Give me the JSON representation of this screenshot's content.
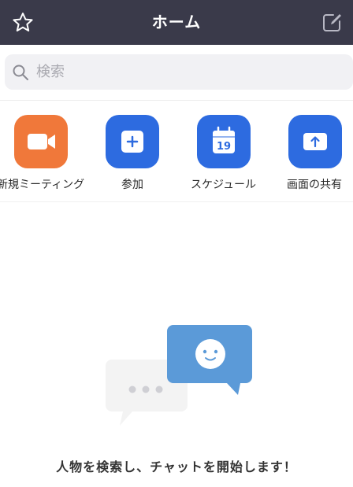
{
  "header": {
    "title": "ホーム",
    "left_icon": "star-icon",
    "right_icon": "edit-icon",
    "background_color": "#3a3a4a"
  },
  "search": {
    "placeholder": "検索",
    "value": ""
  },
  "actions": [
    {
      "label": "新規ミーティング",
      "icon": "video-camera-icon",
      "color": "#f0783a"
    },
    {
      "label": "参加",
      "icon": "plus-icon",
      "color": "#2d6be0"
    },
    {
      "label": "スケジュール",
      "icon": "calendar-icon",
      "color": "#2d6be0",
      "calendar_day": "19"
    },
    {
      "label": "画面の共有",
      "icon": "share-screen-icon",
      "color": "#2d6be0"
    }
  ],
  "empty_state": {
    "message": "人物を検索し、チャットを開始します！",
    "illustration": "chat-bubbles-icon"
  }
}
